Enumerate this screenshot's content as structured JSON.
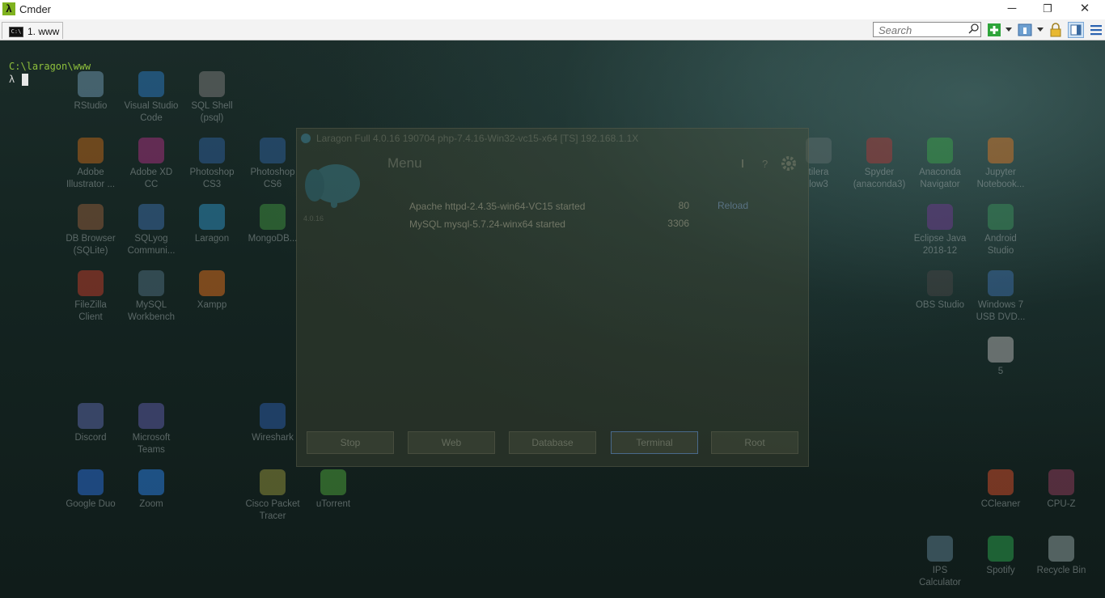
{
  "window": {
    "title": "Cmder",
    "minimize": "─",
    "restore": "❐",
    "close": "✕"
  },
  "tabs": [
    {
      "label": "1. www"
    }
  ],
  "toolbar": {
    "search_placeholder": "Search"
  },
  "console": {
    "path": "C:\\laragon\\www",
    "prompt": "λ",
    "path_color": "#8fc03c",
    "prompt_color": "#d8d8d8"
  },
  "desktop_icons": [
    {
      "label": "RStudio",
      "color": "#6a8fa8"
    },
    {
      "label": "Visual Studio\nCode",
      "color": "#2a74b8"
    },
    {
      "label": "SQL Shell\n(psql)",
      "color": "#777777"
    },
    {
      "label": "Adobe\nIllustrator ...",
      "color": "#b5621a"
    },
    {
      "label": "Adobe XD\nCC",
      "color": "#a0307a"
    },
    {
      "label": "Photoshop\nCS3",
      "color": "#2d5d95"
    },
    {
      "label": "Photoshop\nCS6",
      "color": "#2d5d95"
    },
    {
      "label": "DB Browser\n(SQLite)",
      "color": "#8a5a3a"
    },
    {
      "label": "SQLyog\nCommuni...",
      "color": "#3a6aa0"
    },
    {
      "label": "Laragon",
      "color": "#2e8bb8"
    },
    {
      "label": "MongoDB...",
      "color": "#3e8a3e"
    },
    {
      "label": "FileZilla\nClient",
      "color": "#b53a2a"
    },
    {
      "label": "MySQL\nWorkbench",
      "color": "#4a6a7a"
    },
    {
      "label": "Xampp",
      "color": "#d2691e"
    },
    {
      "label": "Discord",
      "color": "#5865a2"
    },
    {
      "label": "Microsoft\nTeams",
      "color": "#5a5aa0"
    },
    {
      "label": "Wireshark",
      "color": "#2a5aa0"
    },
    {
      "label": "Google Duo",
      "color": "#2a6ad0"
    },
    {
      "label": "Zoom",
      "color": "#2a7ad8"
    },
    {
      "label": "Cisco Packet\nTracer",
      "color": "#8a8a3a"
    },
    {
      "label": "uTorrent",
      "color": "#4a9a3a"
    },
    {
      "label": "tilera\nlow3",
      "color": "#5a6a6a"
    },
    {
      "label": "Spyder\n(anaconda3)",
      "color": "#a03a3a"
    },
    {
      "label": "Anaconda\nNavigator",
      "color": "#3a9a4a"
    },
    {
      "label": "Jupyter\nNotebook...",
      "color": "#c8732a"
    },
    {
      "label": "Eclipse Java\n2018-12",
      "color": "#6a3a8a"
    },
    {
      "label": "Android\nStudio",
      "color": "#3a8a5a"
    },
    {
      "label": "OBS Studio",
      "color": "#444444"
    },
    {
      "label": "Windows 7\nUSB DVD...",
      "color": "#3a6aa0"
    },
    {
      "label": "5",
      "color": "#aaaaaa"
    },
    {
      "label": "CCleaner",
      "color": "#c84a2a"
    },
    {
      "label": "CPU-Z",
      "color": "#8a3a5a"
    },
    {
      "label": "IPS\nCalculator",
      "color": "#5a7a8a"
    },
    {
      "label": "Spotify",
      "color": "#2a9a4a"
    },
    {
      "label": "Recycle Bin",
      "color": "#8a9a9a"
    }
  ],
  "laragon": {
    "title": "Laragon Full 4.0.16 190704 php-7.4.16-Win32-vc15-x64 [TS] 192.168.1.1X",
    "menu": "Menu",
    "version": "4.0.16",
    "services": [
      {
        "name": "Apache httpd-2.4.35-win64-VC15 started",
        "port": "80"
      },
      {
        "name": "MySQL mysql-5.7.24-winx64 started",
        "port": "3306"
      }
    ],
    "reload": "Reload",
    "buttons": [
      "Stop",
      "Web",
      "Database",
      "Terminal",
      "Root"
    ]
  }
}
